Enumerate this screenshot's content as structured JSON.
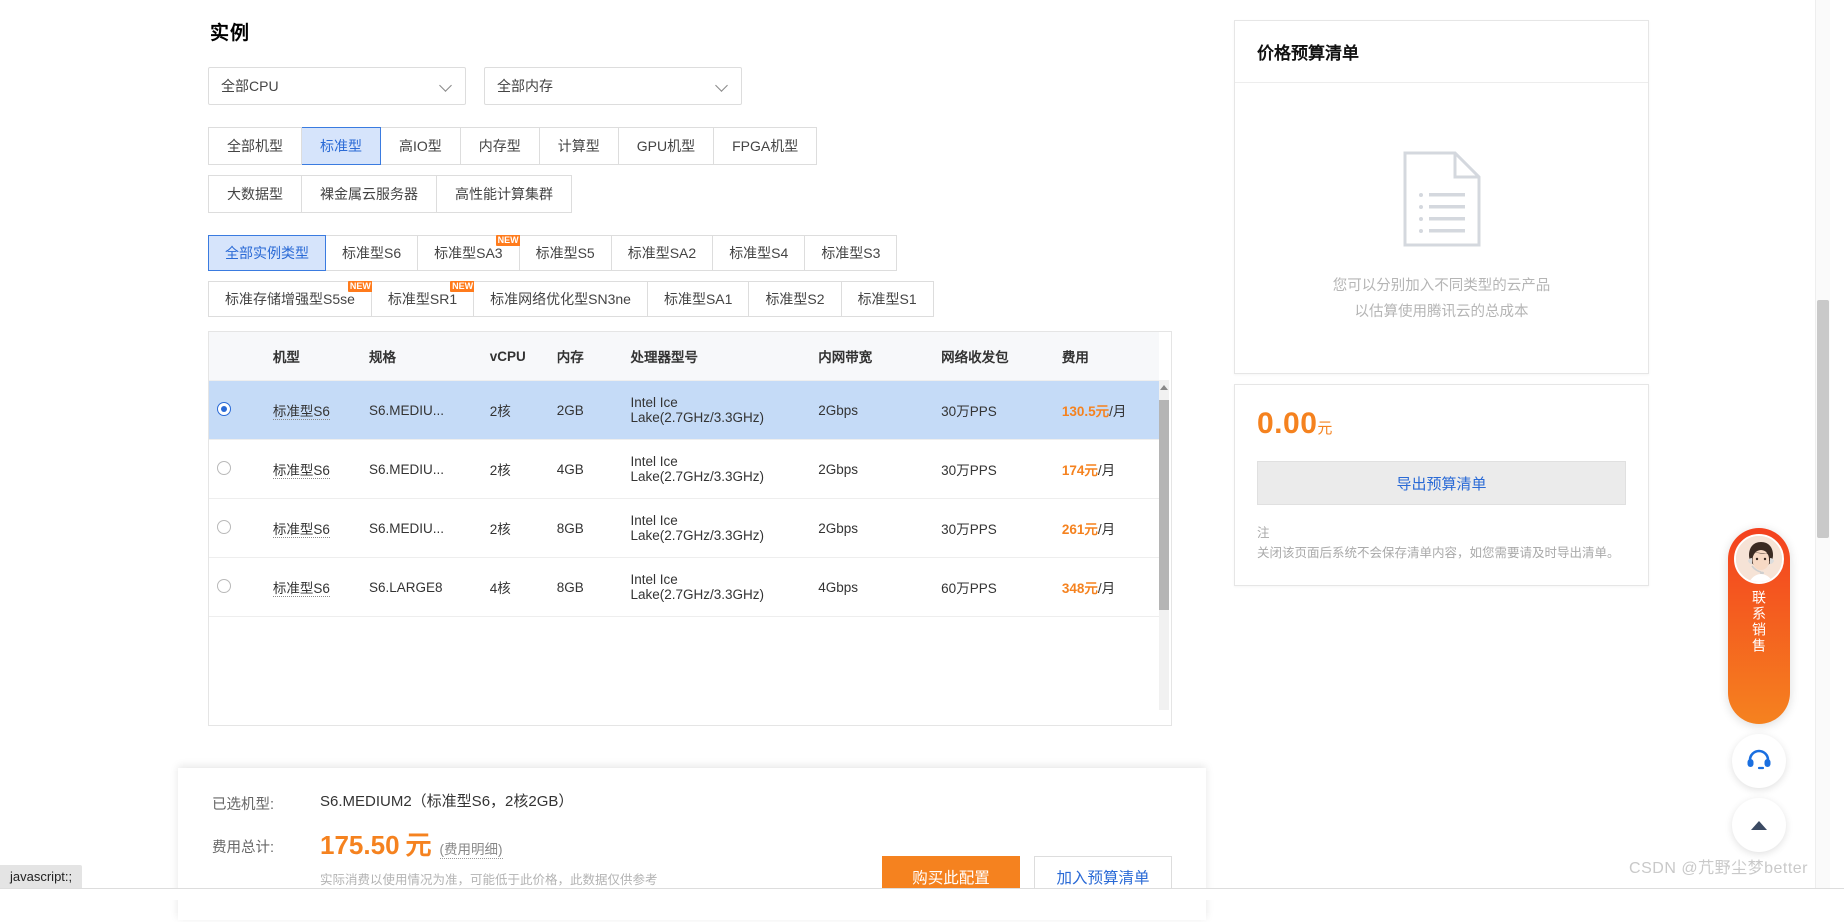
{
  "section": {
    "title": "实例"
  },
  "filters": [
    {
      "name": "cpu-select",
      "value": "全部CPU"
    },
    {
      "name": "memory-select",
      "value": "全部内存"
    }
  ],
  "machine_type_rows": [
    [
      {
        "label": "全部机型",
        "active": false
      },
      {
        "label": "标准型",
        "active": true
      },
      {
        "label": "高IO型",
        "active": false
      },
      {
        "label": "内存型",
        "active": false
      },
      {
        "label": "计算型",
        "active": false
      },
      {
        "label": "GPU机型",
        "active": false
      },
      {
        "label": "FPGA机型",
        "active": false
      }
    ],
    [
      {
        "label": "大数据型",
        "active": false
      },
      {
        "label": "裸金属云服务器",
        "active": false
      },
      {
        "label": "高性能计算集群",
        "active": false
      }
    ]
  ],
  "instance_type_rows": [
    [
      {
        "label": "全部实例类型",
        "active": true,
        "badge": ""
      },
      {
        "label": "标准型S6",
        "active": false,
        "badge": ""
      },
      {
        "label": "标准型SA3",
        "active": false,
        "badge": "NEW"
      },
      {
        "label": "标准型S5",
        "active": false,
        "badge": ""
      },
      {
        "label": "标准型SA2",
        "active": false,
        "badge": ""
      },
      {
        "label": "标准型S4",
        "active": false,
        "badge": ""
      },
      {
        "label": "标准型S3",
        "active": false,
        "badge": ""
      }
    ],
    [
      {
        "label": "标准存储增强型S5se",
        "active": false,
        "badge": "NEW"
      },
      {
        "label": "标准型SR1",
        "active": false,
        "badge": "NEW"
      },
      {
        "label": "标准网络优化型SN3ne",
        "active": false,
        "badge": ""
      },
      {
        "label": "标准型SA1",
        "active": false,
        "badge": ""
      },
      {
        "label": "标准型S2",
        "active": false,
        "badge": ""
      },
      {
        "label": "标准型S1",
        "active": false,
        "badge": ""
      }
    ]
  ],
  "table": {
    "headers": [
      "机型",
      "规格",
      "vCPU",
      "内存",
      "处理器型号",
      "内网带宽",
      "网络收发包",
      "费用"
    ],
    "rows": [
      {
        "selected": true,
        "model": "标准型S6",
        "spec": "S6.MEDIU...",
        "vcpu": "2核",
        "memory": "2GB",
        "cpu": "Intel Ice Lake(2.7GHz/3.3GHz)",
        "bandwidth": "2Gbps",
        "pps": "30万PPS",
        "price_value": "130.5",
        "price_unit": "元",
        "price_per": "/月"
      },
      {
        "selected": false,
        "model": "标准型S6",
        "spec": "S6.MEDIU...",
        "vcpu": "2核",
        "memory": "4GB",
        "cpu": "Intel Ice Lake(2.7GHz/3.3GHz)",
        "bandwidth": "2Gbps",
        "pps": "30万PPS",
        "price_value": "174",
        "price_unit": "元",
        "price_per": "/月"
      },
      {
        "selected": false,
        "model": "标准型S6",
        "spec": "S6.MEDIU...",
        "vcpu": "2核",
        "memory": "8GB",
        "cpu": "Intel Ice Lake(2.7GHz/3.3GHz)",
        "bandwidth": "2Gbps",
        "pps": "30万PPS",
        "price_value": "261",
        "price_unit": "元",
        "price_per": "/月"
      },
      {
        "selected": false,
        "model": "标准型S6",
        "spec": "S6.LARGE8",
        "vcpu": "4核",
        "memory": "8GB",
        "cpu": "Intel Ice Lake(2.7GHz/3.3GHz)",
        "bandwidth": "4Gbps",
        "pps": "60万PPS",
        "price_value": "348",
        "price_unit": "元",
        "price_per": "/月"
      }
    ]
  },
  "budget_panel": {
    "title": "价格预算清单",
    "empty_line1": "您可以分别加入不同类型的云产品",
    "empty_line2": "以估算使用腾讯云的总成本",
    "total_amount": "0.00",
    "total_unit": "元",
    "export_label": "导出预算清单",
    "note_title": "注",
    "note_body": "关闭该页面后系统不会保存清单内容，如您需要请及时导出清单。"
  },
  "bottom_bar": {
    "selected_label": "已选机型:",
    "selected_value": "S6.MEDIUM2（标准型S6，2核2GB）",
    "total_label": "费用总计:",
    "total_amount": "175.50",
    "total_unit": "元",
    "detail_link": "(费用明细)",
    "hint": "实际消费以使用情况为准，可能低于此价格，此数据仅供参考",
    "buy_label": "购买此配置",
    "add_label": "加入预算清单"
  },
  "floating": {
    "sales_text": "联系销售",
    "service_icon": "headset-icon",
    "back_to_top_icon": "chevron-up-icon"
  },
  "browser": {
    "status_text": "javascript:;",
    "watermark": "CSDN @芁野尘梦better"
  },
  "colors": {
    "accent_orange": "#f5821f",
    "link_blue": "#2a6ad6",
    "selected_row": "#c5dbf7",
    "active_tab_bg": "#d6e4fb",
    "badge_orange": "#ff7b1c"
  }
}
